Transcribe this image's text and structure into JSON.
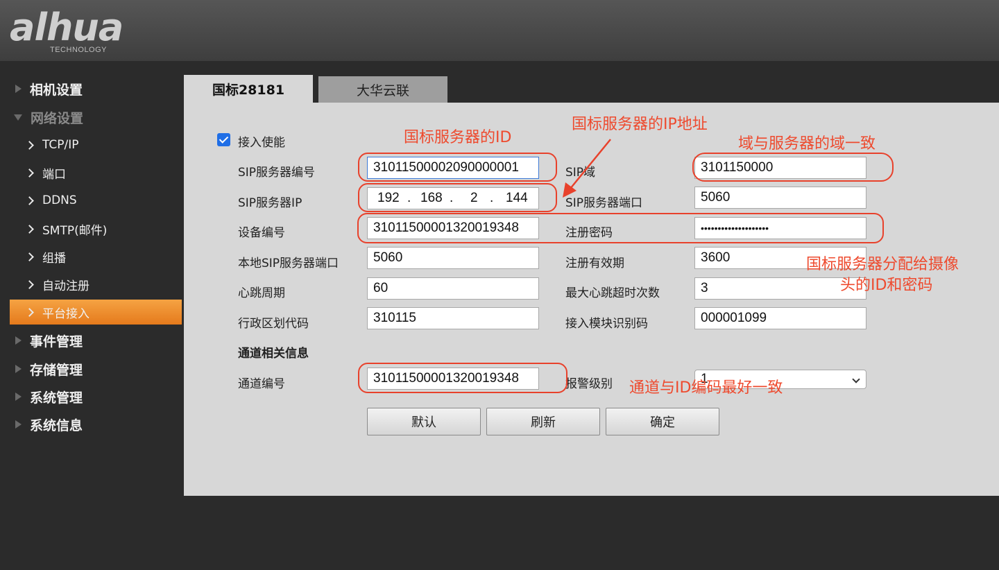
{
  "brand": {
    "logo_text": "alhua",
    "logo_sub": "TECHNOLOGY"
  },
  "sidebar": {
    "items": [
      {
        "label": "相机设置"
      },
      {
        "label": "网络设置"
      },
      {
        "label": "事件管理"
      },
      {
        "label": "存储管理"
      },
      {
        "label": "系统管理"
      },
      {
        "label": "系统信息"
      }
    ],
    "network_sub": [
      {
        "label": "TCP/IP"
      },
      {
        "label": "端口"
      },
      {
        "label": "DDNS"
      },
      {
        "label": "SMTP(邮件)"
      },
      {
        "label": "组播"
      },
      {
        "label": "自动注册"
      },
      {
        "label": "平台接入",
        "active": true
      }
    ]
  },
  "tabs": [
    {
      "label": "国标28181",
      "active": true
    },
    {
      "label": "大华云联",
      "active": false
    }
  ],
  "form": {
    "enable_label": "接入使能",
    "enable_checked": true,
    "sip_server_id_label": "SIP服务器编号",
    "sip_server_id": "31011500002090000001",
    "sip_domain_label": "SIP域",
    "sip_domain": "3101150000",
    "sip_server_ip_label": "SIP服务器IP",
    "sip_server_ip": [
      "192",
      "168",
      "2",
      "144"
    ],
    "sip_server_port_label": "SIP服务器端口",
    "sip_server_port": "5060",
    "device_id_label": "设备编号",
    "device_id": "31011500001320019348",
    "reg_password_label": "注册密码",
    "reg_password": "••••••••••••••••••••",
    "local_sip_port_label": "本地SIP服务器端口",
    "local_sip_port": "5060",
    "reg_validity_label": "注册有效期",
    "reg_validity": "3600",
    "heartbeat_label": "心跳周期",
    "heartbeat": "60",
    "max_timeout_label": "最大心跳超时次数",
    "max_timeout": "3",
    "region_code_label": "行政区划代码",
    "region_code": "310115",
    "module_id_label": "接入模块识别码",
    "module_id": "000001099",
    "channel_section_label": "通道相关信息",
    "channel_id_label": "通道编号",
    "channel_id": "31011500001320019348",
    "alarm_level_label": "报警级别",
    "alarm_level": "1"
  },
  "buttons": {
    "default": "默认",
    "refresh": "刷新",
    "confirm": "确定"
  },
  "annotations": {
    "server_id": "国标服务器的ID",
    "server_ip": "国标服务器的IP地址",
    "domain": "域与服务器的域一致",
    "assigned_line1": "国标服务器分配给摄像",
    "assigned_line2": "头的ID和密码",
    "channel": "通道与ID编码最好一致",
    "color": "#ee4a2e"
  }
}
